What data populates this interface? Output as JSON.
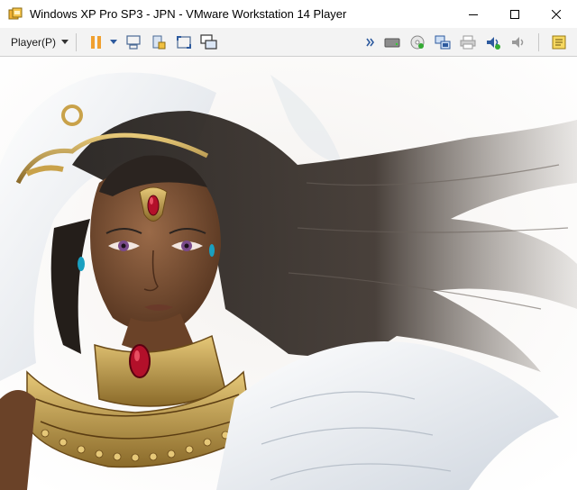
{
  "window": {
    "title": "Windows XP Pro SP3 - JPN - VMware Workstation 14 Player",
    "icon": "vmware-player-icon"
  },
  "window_controls": [
    "minimize-icon",
    "maximize-icon",
    "close-icon"
  ],
  "toolbar": {
    "player_menu_label": "Player(P)",
    "left_buttons": [
      "pause-icon",
      "dropdown-arrow-icon",
      "send-ctrl-alt-del-icon",
      "removable-devices-icon",
      "full-screen-icon",
      "unity-icon"
    ],
    "right_buttons": [
      "more-chevron-icon",
      "hard-disk-icon",
      "cd-dvd-icon",
      "network-adapter-icon",
      "printer-icon",
      "sound-card-icon",
      "usb-sound-icon",
      "message-log-icon"
    ]
  },
  "guest_display": {
    "content": "desktop wallpaper illustration",
    "colors": {
      "background": "#ffffff",
      "skin": "#8a5a3a",
      "hair": "#2b2420",
      "gold": "#c9a24a",
      "gem": "#b3102a"
    }
  }
}
